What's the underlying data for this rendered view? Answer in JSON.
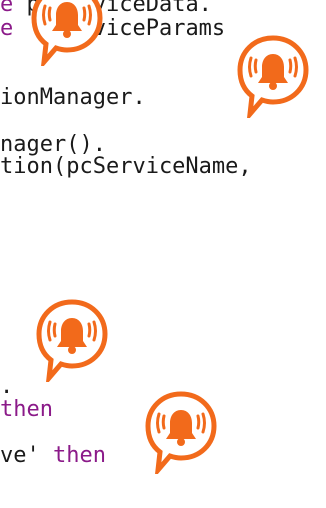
{
  "code_lines": [
    {
      "seg": [
        {
          "t": "e ",
          "k": "kw"
        },
        {
          "t": "pcServiceData.",
          "k": "txt"
        }
      ]
    },
    {
      "seg": [
        {
          "t": "e ",
          "k": "kw"
        },
        {
          "t": "     viceParams",
          "k": "txt"
        }
      ]
    },
    {
      "seg": [
        {
          "t": "",
          "k": "txt"
        }
      ]
    },
    {
      "seg": [
        {
          "t": "",
          "k": "txt"
        }
      ]
    },
    {
      "seg": [
        {
          "t": "ionManager.",
          "k": "txt"
        }
      ]
    },
    {
      "seg": [
        {
          "t": "",
          "k": "txt"
        }
      ]
    },
    {
      "seg": [
        {
          "t": "nager().",
          "k": "txt"
        }
      ]
    },
    {
      "seg": [
        {
          "t": "tion(pcServiceName,",
          "k": "txt"
        }
      ]
    },
    {
      "seg": [
        {
          "t": "",
          "k": "txt"
        }
      ]
    },
    {
      "seg": [
        {
          "t": "",
          "k": "txt"
        }
      ]
    },
    {
      "seg": [
        {
          "t": "",
          "k": "txt"
        }
      ]
    },
    {
      "seg": [
        {
          "t": "",
          "k": "txt"
        }
      ]
    },
    {
      "seg": [
        {
          "t": "",
          "k": "txt"
        }
      ]
    },
    {
      "seg": [
        {
          "t": "",
          "k": "txt"
        }
      ]
    },
    {
      "seg": [
        {
          "t": ".",
          "k": "txt"
        }
      ]
    },
    {
      "seg": [
        {
          "t": "then",
          "k": "kw"
        }
      ]
    },
    {
      "seg": [
        {
          "t": "",
          "k": "txt"
        }
      ]
    },
    {
      "seg": [
        {
          "t": "ve' ",
          "k": "str"
        },
        {
          "t": "then",
          "k": "kw"
        }
      ]
    }
  ],
  "notifications": [
    {
      "icon": "bell-notification-icon"
    },
    {
      "icon": "bell-notification-icon"
    },
    {
      "icon": "bell-notification-icon"
    },
    {
      "icon": "bell-notification-icon"
    }
  ],
  "colors": {
    "keyword": "#8b1a89",
    "text": "#1a1a1a",
    "bell": "#f26a1b",
    "background": "#ffffff"
  }
}
